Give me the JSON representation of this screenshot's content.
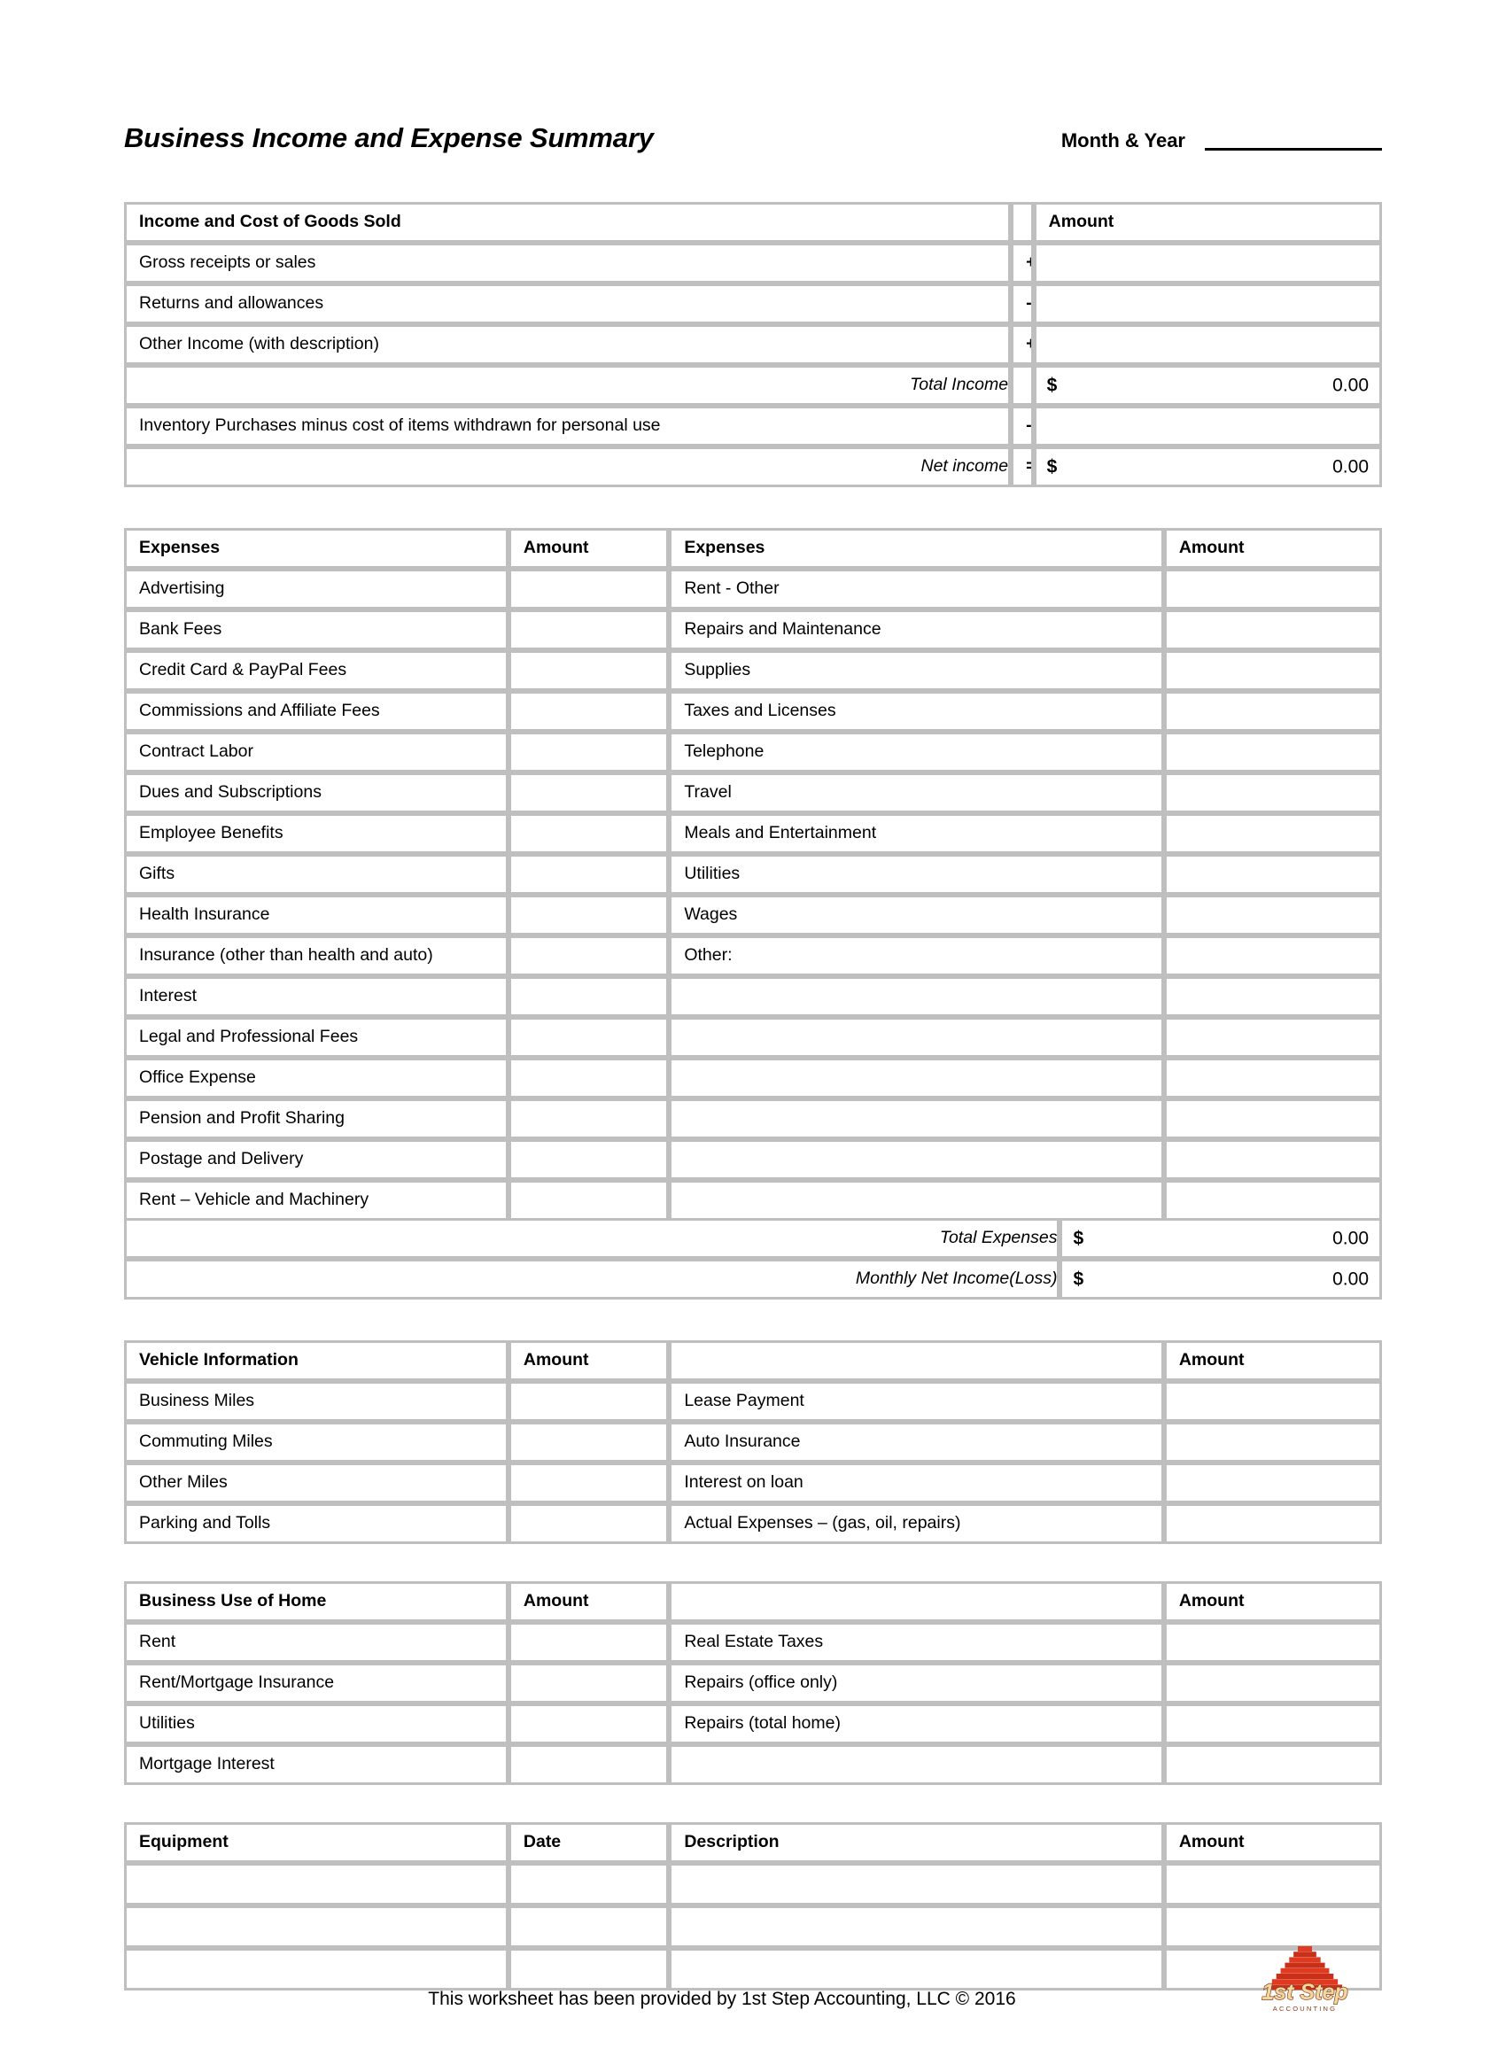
{
  "document": {
    "title": "Business Income and Expense Summary",
    "month_year_label": "Month & Year",
    "month_year_value": ""
  },
  "income_table": {
    "header": {
      "label": "Income and Cost of Goods Sold",
      "sign": "",
      "amount": "Amount"
    },
    "rows": [
      {
        "label": "Gross receipts or sales",
        "sign": "+",
        "amount": ""
      },
      {
        "label": "Returns and allowances",
        "sign": "-",
        "amount": ""
      },
      {
        "label": "Other Income (with description)",
        "sign": "+",
        "amount": ""
      }
    ],
    "total_income": {
      "label": "Total Income",
      "sign": "",
      "currency": "$",
      "value": "0.00"
    },
    "inventory_row": {
      "label": "Inventory Purchases minus cost of items withdrawn for personal use",
      "sign": "-",
      "amount": ""
    },
    "net_income": {
      "label": "Net income",
      "sign": "=",
      "currency": "$",
      "value": "0.00"
    }
  },
  "expenses_table": {
    "header": {
      "left_label": "Expenses",
      "left_amount": "Amount",
      "right_label": "Expenses",
      "right_amount": "Amount"
    },
    "rows": [
      {
        "left": "Advertising",
        "left_amount": "",
        "right": "Rent - Other",
        "right_amount": ""
      },
      {
        "left": "Bank Fees",
        "left_amount": "",
        "right": "Repairs and Maintenance",
        "right_amount": ""
      },
      {
        "left": "Credit Card & PayPal Fees",
        "left_amount": "",
        "right": "Supplies",
        "right_amount": ""
      },
      {
        "left": "Commissions and Affiliate Fees",
        "left_amount": "",
        "right": "Taxes and Licenses",
        "right_amount": ""
      },
      {
        "left": "Contract Labor",
        "left_amount": "",
        "right": "Telephone",
        "right_amount": ""
      },
      {
        "left": "Dues and Subscriptions",
        "left_amount": "",
        "right": "Travel",
        "right_amount": ""
      },
      {
        "left": "Employee Benefits",
        "left_amount": "",
        "right": "Meals and Entertainment",
        "right_amount": ""
      },
      {
        "left": "Gifts",
        "left_amount": "",
        "right": "Utilities",
        "right_amount": ""
      },
      {
        "left": "Health Insurance",
        "left_amount": "",
        "right": "Wages",
        "right_amount": ""
      },
      {
        "left": "Insurance (other than health and auto)",
        "left_amount": "",
        "right": "Other:",
        "right_amount": ""
      },
      {
        "left": "Interest",
        "left_amount": "",
        "right": "",
        "right_amount": ""
      },
      {
        "left": "Legal and Professional Fees",
        "left_amount": "",
        "right": "",
        "right_amount": ""
      },
      {
        "left": "Office Expense",
        "left_amount": "",
        "right": "",
        "right_amount": ""
      },
      {
        "left": "Pension and Profit Sharing",
        "left_amount": "",
        "right": "",
        "right_amount": ""
      },
      {
        "left": "Postage and Delivery",
        "left_amount": "",
        "right": "",
        "right_amount": ""
      },
      {
        "left": "Rent – Vehicle and Machinery",
        "left_amount": "",
        "right": "",
        "right_amount": ""
      }
    ],
    "total_expenses": {
      "label": "Total Expenses",
      "currency": "$",
      "value": "0.00"
    },
    "monthly_net_income": {
      "label": "Monthly Net Income(Loss)",
      "currency": "$",
      "value": "0.00"
    }
  },
  "vehicle_table": {
    "header": {
      "left_label": "Vehicle Information",
      "left_amount": "Amount",
      "right_label": "",
      "right_amount": "Amount"
    },
    "rows": [
      {
        "left": "Business Miles",
        "left_amount": "",
        "right": "Lease Payment",
        "right_amount": ""
      },
      {
        "left": "Commuting Miles",
        "left_amount": "",
        "right": "Auto Insurance",
        "right_amount": ""
      },
      {
        "left": "Other Miles",
        "left_amount": "",
        "right": "Interest on loan",
        "right_amount": ""
      },
      {
        "left": "Parking and Tolls",
        "left_amount": "",
        "right": "Actual Expenses –  (gas, oil, repairs)",
        "right_amount": ""
      }
    ]
  },
  "home_table": {
    "header": {
      "left_label": "Business Use of Home",
      "left_amount": "Amount",
      "right_label": "",
      "right_amount": "Amount"
    },
    "rows": [
      {
        "left": "Rent",
        "left_amount": "",
        "right": "Real Estate Taxes",
        "right_amount": ""
      },
      {
        "left": "Rent/Mortgage Insurance",
        "left_amount": "",
        "right": "Repairs (office only)",
        "right_amount": ""
      },
      {
        "left": "Utilities",
        "left_amount": "",
        "right": "Repairs (total home)",
        "right_amount": ""
      },
      {
        "left": "Mortgage Interest",
        "left_amount": "",
        "right": "",
        "right_amount": ""
      }
    ]
  },
  "equipment_table": {
    "header": {
      "equipment": "Equipment",
      "date": "Date",
      "description": "Description",
      "amount": "Amount"
    },
    "rows": [
      {
        "equipment": "",
        "date": "",
        "description": "",
        "amount": ""
      },
      {
        "equipment": "",
        "date": "",
        "description": "",
        "amount": ""
      },
      {
        "equipment": "",
        "date": "",
        "description": "",
        "amount": ""
      }
    ]
  },
  "footer": {
    "text": "This worksheet has been provided by 1st Step Accounting, LLC © 2016",
    "logo_name": "1st Step",
    "logo_subtitle": "ACCOUNTING",
    "logo_color": "#e03a20",
    "logo_text_color": "#f0d9a0"
  }
}
